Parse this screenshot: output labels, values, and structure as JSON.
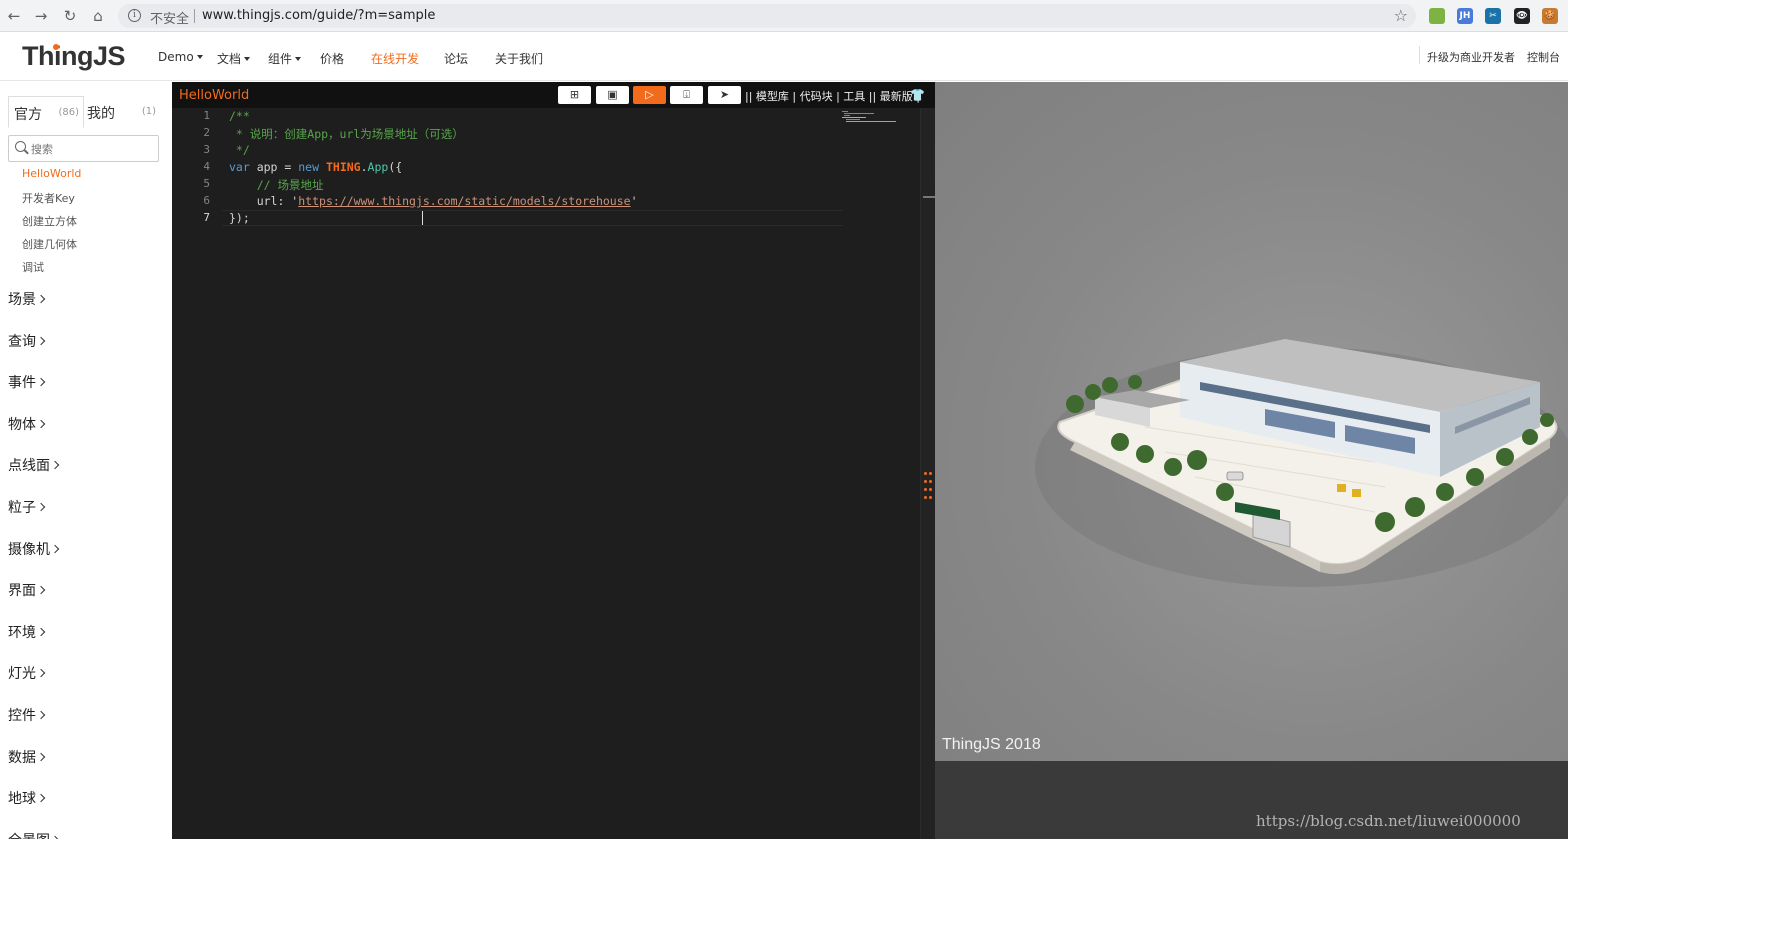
{
  "browser": {
    "insecure_label": "不安全",
    "url": "www.thingjs.com/guide/?m=sample",
    "extensions": [
      {
        "icon": "extension-green-icon",
        "label": "",
        "color": "#7cb342"
      },
      {
        "icon": "extension-jh-icon",
        "label": "JH",
        "color": "#4a7bd8"
      },
      {
        "icon": "extension-scissors-icon",
        "label": "✂",
        "color": "#1a73a8"
      },
      {
        "icon": "extension-eye-icon",
        "label": "👁",
        "color": "#222222"
      },
      {
        "icon": "extension-cookie-icon",
        "label": "🍪",
        "color": "#c77b30"
      }
    ]
  },
  "header": {
    "logo": "ThingJS",
    "accent_color": "#f26b1d",
    "nav": [
      {
        "label": "Demo",
        "dropdown": true
      },
      {
        "label": "文档",
        "dropdown": true
      },
      {
        "label": "组件",
        "dropdown": true
      },
      {
        "label": "价格",
        "dropdown": false
      },
      {
        "label": "在线开发",
        "dropdown": false,
        "active": true
      },
      {
        "label": "论坛",
        "dropdown": false
      },
      {
        "label": "关于我们",
        "dropdown": false
      }
    ],
    "upgrade_label": "升级为商业开发者",
    "console_label": "控制台"
  },
  "sidebar": {
    "tabs": [
      {
        "label": "官方",
        "count": "(86)"
      },
      {
        "label": "我的",
        "count": "(1)"
      }
    ],
    "search_placeholder": "搜索",
    "samples": [
      "HelloWorld",
      "开发者Key",
      "创建立方体",
      "创建几何体",
      "调试"
    ],
    "active_sample": "HelloWorld",
    "categories": [
      "场景",
      "查询",
      "事件",
      "物体",
      "点线面",
      "粒子",
      "摄像机",
      "界面",
      "环境",
      "灯光",
      "控件",
      "数据",
      "地球",
      "全景图"
    ]
  },
  "editor": {
    "title": "HelloWorld",
    "toolbar_icons": [
      "new-file-icon",
      "save-icon",
      "run-icon",
      "export-icon",
      "send-icon"
    ],
    "links": "|| 模型库 | 代码块 | 工具 || 最新版 |",
    "line_numbers": [
      "1",
      "2",
      "3",
      "4",
      "5",
      "6",
      "7"
    ],
    "code": {
      "l1": "/**",
      "l2": " * 说明：创建App，url为场景地址（可选）",
      "l3": " */",
      "l4_kw": "var",
      "l4_mid": " app = ",
      "l4_new": "new",
      "l4_cls": "THING",
      "l4_fn": "App",
      "l4_end": "({",
      "l5": "    // 场景地址",
      "l6_key": "    url: '",
      "l6_url": "https://www.thingjs.com/static/models/storehouse",
      "l6_end": "'",
      "l7": "});"
    }
  },
  "preview": {
    "caption": "ThingJS 2018",
    "watermark": "https://blog.csdn.net/liuwei000000"
  }
}
